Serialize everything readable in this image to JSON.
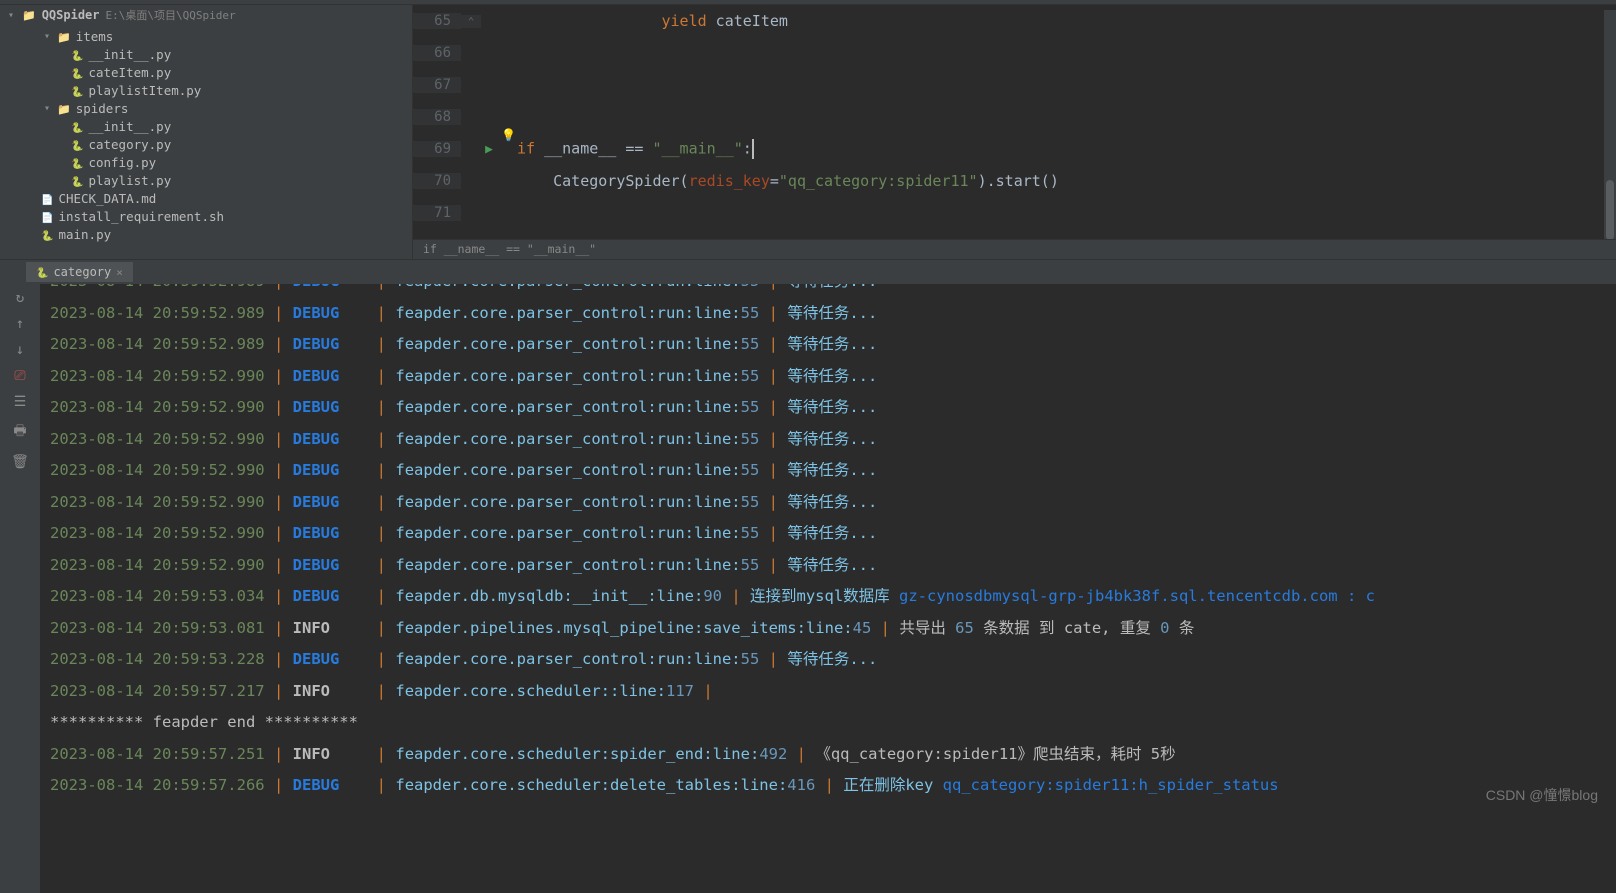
{
  "project": {
    "name": "QQSpider",
    "path": "E:\\桌面\\项目\\QQSpider"
  },
  "tree": [
    {
      "depth": 1,
      "chev": "▾",
      "icon": "ic-folder",
      "label": "items"
    },
    {
      "depth": 2,
      "chev": "",
      "icon": "ic-py",
      "label": "__init__.py"
    },
    {
      "depth": 2,
      "chev": "",
      "icon": "ic-py",
      "label": "cateItem.py"
    },
    {
      "depth": 2,
      "chev": "",
      "icon": "ic-py",
      "label": "playlistItem.py"
    },
    {
      "depth": 1,
      "chev": "▾",
      "icon": "ic-folder",
      "label": "spiders"
    },
    {
      "depth": 2,
      "chev": "",
      "icon": "ic-py",
      "label": "__init__.py"
    },
    {
      "depth": 2,
      "chev": "",
      "icon": "ic-py",
      "label": "category.py"
    },
    {
      "depth": 2,
      "chev": "",
      "icon": "ic-py",
      "label": "config.py"
    },
    {
      "depth": 2,
      "chev": "",
      "icon": "ic-py",
      "label": "playlist.py"
    },
    {
      "depth": 0,
      "chev": "",
      "icon": "ic-md",
      "label": "CHECK_DATA.md"
    },
    {
      "depth": 0,
      "chev": "",
      "icon": "ic-sh",
      "label": "install_requirement.sh"
    },
    {
      "depth": 0,
      "chev": "",
      "icon": "ic-py",
      "label": "main.py"
    }
  ],
  "code": {
    "lines": [
      {
        "n": "65",
        "fold": "⌃",
        "html": "                <span class='kw'>yield</span> cateItem"
      },
      {
        "n": "66",
        "fold": "",
        "html": ""
      },
      {
        "n": "67",
        "fold": "",
        "html": ""
      },
      {
        "n": "68",
        "fold": "",
        "html": ""
      },
      {
        "n": "69",
        "fold": "",
        "html": "<span class='kw'>if</span> __name__ == <span class='str'>\"__main__\"</span>:<span class='caret'></span>",
        "run": true
      },
      {
        "n": "70",
        "fold": "",
        "html": "    CategorySpider(<span class='param'>redis_key</span>=<span class='str'>\"qq_category:spider11\"</span>).start()"
      },
      {
        "n": "71",
        "fold": "",
        "html": ""
      }
    ],
    "breadcrumb": "if __name__ == \"__main__\""
  },
  "run": {
    "tab": "category",
    "logs": [
      {
        "ts": "2023-08-14 20:59:52.989",
        "lvl": "DEBUG",
        "src": "feapder.core.parser_control:run:line:",
        "ln": "55",
        "msg": "等待任务...",
        "cls": "msg"
      },
      {
        "ts": "2023-08-14 20:59:52.989",
        "lvl": "DEBUG",
        "src": "feapder.core.parser_control:run:line:",
        "ln": "55",
        "msg": "等待任务...",
        "cls": "msg"
      },
      {
        "ts": "2023-08-14 20:59:52.990",
        "lvl": "DEBUG",
        "src": "feapder.core.parser_control:run:line:",
        "ln": "55",
        "msg": "等待任务...",
        "cls": "msg"
      },
      {
        "ts": "2023-08-14 20:59:52.990",
        "lvl": "DEBUG",
        "src": "feapder.core.parser_control:run:line:",
        "ln": "55",
        "msg": "等待任务...",
        "cls": "msg"
      },
      {
        "ts": "2023-08-14 20:59:52.990",
        "lvl": "DEBUG",
        "src": "feapder.core.parser_control:run:line:",
        "ln": "55",
        "msg": "等待任务...",
        "cls": "msg"
      },
      {
        "ts": "2023-08-14 20:59:52.990",
        "lvl": "DEBUG",
        "src": "feapder.core.parser_control:run:line:",
        "ln": "55",
        "msg": "等待任务...",
        "cls": "msg"
      },
      {
        "ts": "2023-08-14 20:59:52.990",
        "lvl": "DEBUG",
        "src": "feapder.core.parser_control:run:line:",
        "ln": "55",
        "msg": "等待任务...",
        "cls": "msg"
      },
      {
        "ts": "2023-08-14 20:59:52.990",
        "lvl": "DEBUG",
        "src": "feapder.core.parser_control:run:line:",
        "ln": "55",
        "msg": "等待任务...",
        "cls": "msg"
      },
      {
        "ts": "2023-08-14 20:59:52.990",
        "lvl": "DEBUG",
        "src": "feapder.core.parser_control:run:line:",
        "ln": "55",
        "msg": "等待任务...",
        "cls": "msg"
      },
      {
        "ts": "2023-08-14 20:59:53.034",
        "lvl": "DEBUG",
        "src": "feapder.db.mysqldb:__init__:line:",
        "ln": "90",
        "msg": "连接到mysql数据库 <span class='hl'>gz-cynosdbmysql-grp-jb4bk38f.sql.tencentcdb.com : c</span>",
        "cls": "msg"
      },
      {
        "ts": "2023-08-14 20:59:53.081",
        "lvl": "INFO",
        "src": "feapder.pipelines.mysql_pipeline:save_items:line:",
        "ln": "45",
        "msg": "共导出 <span class='num'>65</span> 条数据 到 cate, 重复 <span class='num'>0</span> 条",
        "cls": "msg-w"
      },
      {
        "ts": "2023-08-14 20:59:53.228",
        "lvl": "DEBUG",
        "src": "feapder.core.parser_control:run:line:",
        "ln": "55",
        "msg": "等待任务...",
        "cls": "msg"
      },
      {
        "ts": "2023-08-14 20:59:57.217",
        "lvl": "INFO",
        "src": "feapder.core.scheduler:<lambda>:line:",
        "ln": "117",
        "msg": "",
        "cls": "msg"
      },
      {
        "raw": "********** feapder end **********"
      },
      {
        "ts": "2023-08-14 20:59:57.251",
        "lvl": "INFO",
        "src": "feapder.core.scheduler:spider_end:line:",
        "ln": "492",
        "msg": "《qq_category:spider11》爬虫结束，耗时 5秒",
        "cls": "msg-w"
      },
      {
        "ts": "2023-08-14 20:59:57.266",
        "lvl": "DEBUG",
        "src": "feapder.core.scheduler:delete_tables:line:",
        "ln": "416",
        "msg": "正在删除key <span class='hl'>qq_category:spider11:h_spider_status</span>",
        "cls": "msg"
      }
    ]
  },
  "watermark": "CSDN @憧憬blog"
}
